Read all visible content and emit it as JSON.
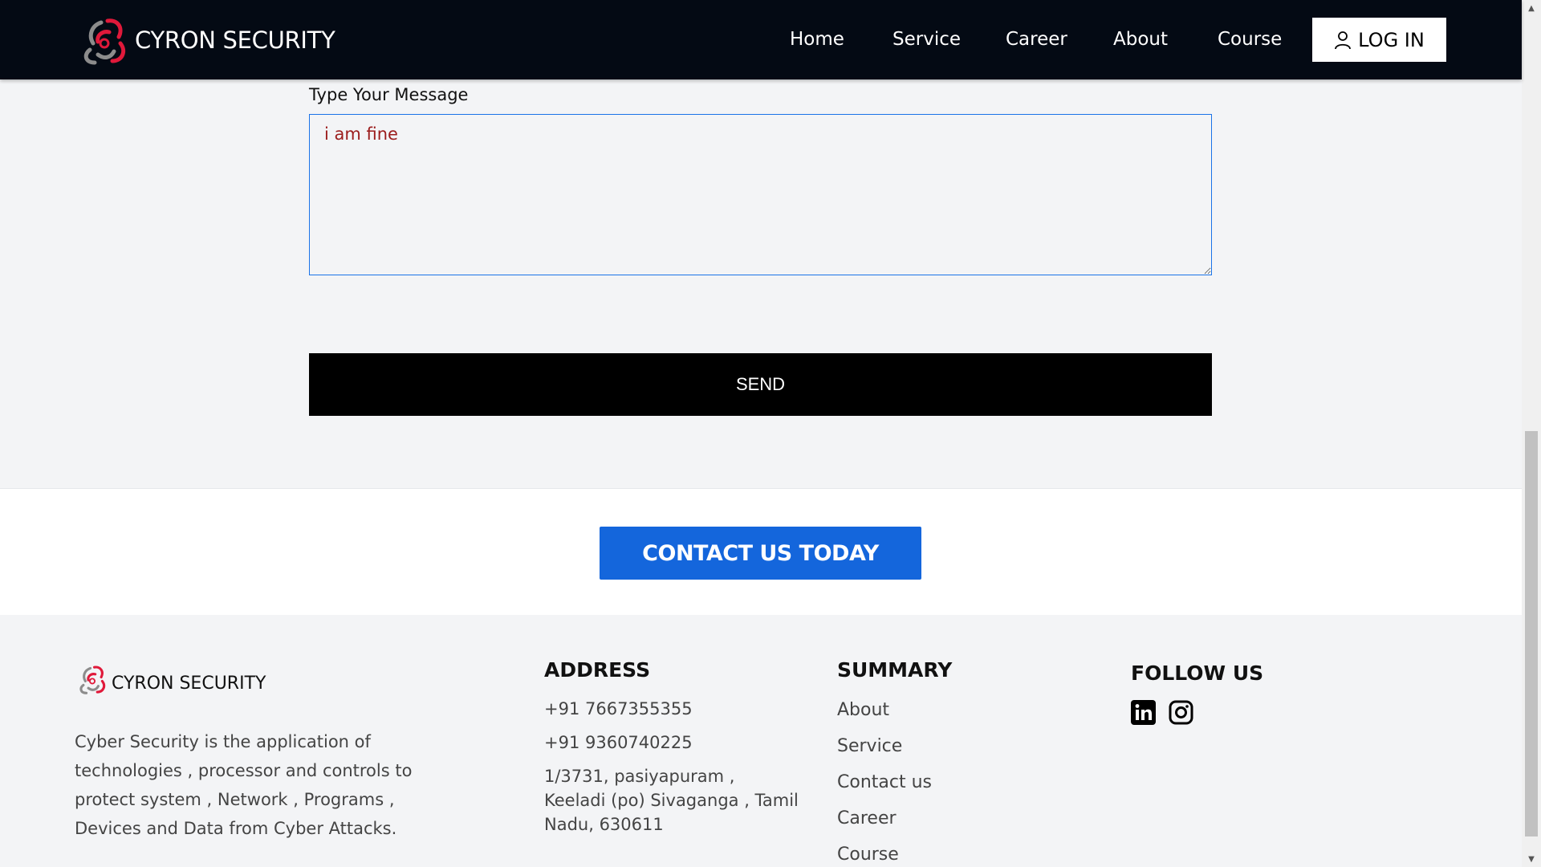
{
  "navbar": {
    "brand": "CYRON SECURITY",
    "links": [
      "Home",
      "Service",
      "Career",
      "About",
      "Course"
    ],
    "login_label": "LOG IN"
  },
  "form": {
    "message_label": "Type Your Message",
    "message_value": "i am fine",
    "send_label": "SEND"
  },
  "cta": {
    "label": "CONTACT US TODAY"
  },
  "footer": {
    "brand": "CYRON SECURITY",
    "description": "Cyber Security is the application of technologies , processor and controls to protect system , Network , Programs , Devices and Data from Cyber Attacks.",
    "address": {
      "title": "ADDRESS",
      "phone1": "+91 7667355355",
      "phone2": "+91 9360740225",
      "street": "1/3731, pasiyapuram , Keeladi (po) Sivaganga , Tamil Nadu, 630611"
    },
    "summary": {
      "title": "SUMMARY",
      "items": [
        "About",
        "Service",
        "Contact us",
        "Career",
        "Course"
      ]
    },
    "follow": {
      "title": "FOLLOW US",
      "icons": [
        "linkedin-icon",
        "instagram-icon"
      ]
    }
  },
  "colors": {
    "navbar_bg": "#040a14",
    "accent_red": "#e0193a",
    "cta_blue": "#1466dc",
    "input_border": "#1a73e8",
    "input_text": "#9b1c1c"
  }
}
